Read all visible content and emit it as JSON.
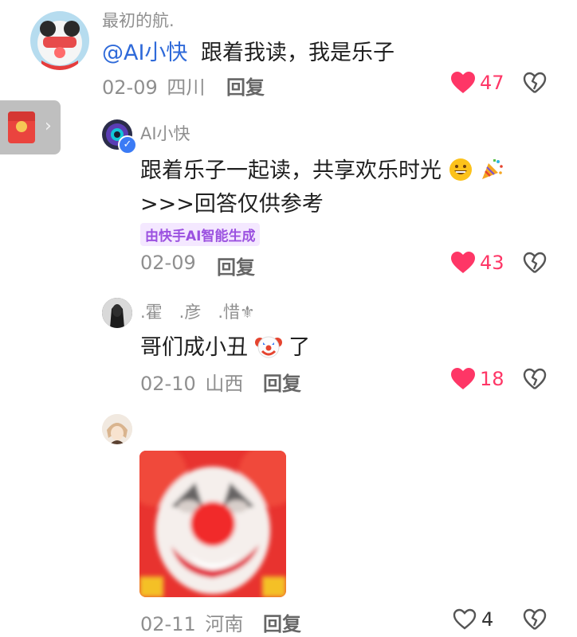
{
  "comments": [
    {
      "username": "最初的航.",
      "mention": "@AI小快",
      "text": "跟着我读，我是乐子",
      "date": "02-09",
      "location": "四川",
      "reply_label": "回复",
      "like_count": "47",
      "liked": true
    },
    {
      "username": "AI小快",
      "text_line1": "跟着乐子一起读，共享欢乐时光",
      "text_line2": ">>>回答仅供参考",
      "ai_tag": "由快手AI智能生成",
      "date": "02-09",
      "reply_label": "回复",
      "like_count": "43",
      "liked": true
    },
    {
      "username": ".霍　.彦　.惜⚜",
      "text_before": "哥们成小丑",
      "text_after": "了",
      "date": "02-10",
      "location": "山西",
      "reply_label": "回复",
      "like_count": "18",
      "liked": true
    },
    {
      "username": "",
      "date": "02-11",
      "location": "河南",
      "reply_label": "回复",
      "like_count": "4",
      "liked": false
    }
  ],
  "colors": {
    "like_active": "#fe3666",
    "mention": "#2f6ad9",
    "ai_tag_bg": "#f4e8ff",
    "ai_tag_text": "#9b51e0"
  },
  "icons": {
    "heart": "heart-icon",
    "dislike": "broken-heart-icon",
    "red_packet": "red-envelope-icon",
    "verified": "verified-badge-icon"
  }
}
